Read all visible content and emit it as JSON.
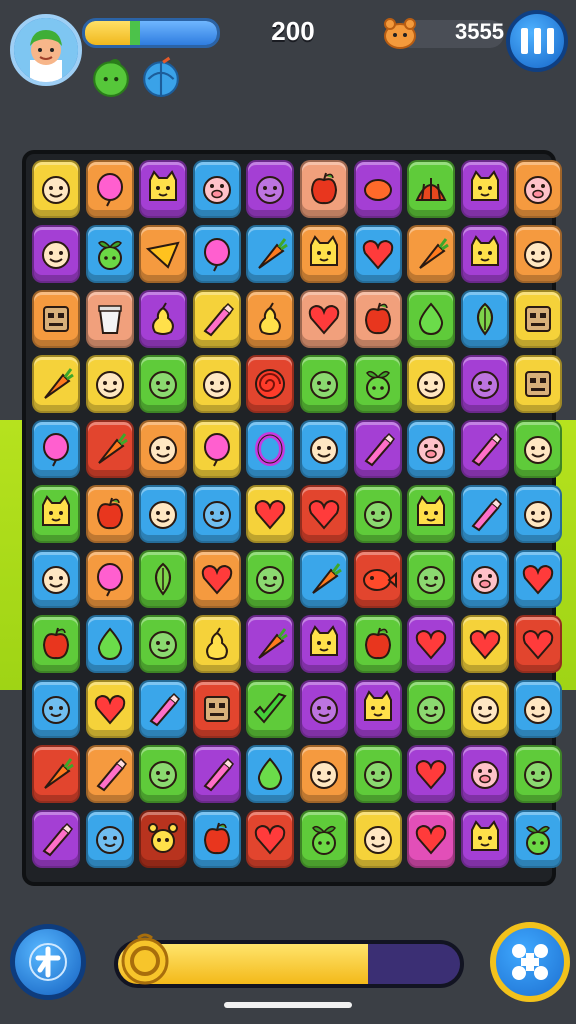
{
  "hud": {
    "score": "200",
    "coins": "3555",
    "xp_fraction": 0.37,
    "boosters": [
      "green-apple-icon",
      "blue-ball-icon"
    ],
    "pause_icon": "pause-icon"
  },
  "footer": {
    "hint_icon": "hint-icon",
    "shuffle_icon": "shuffle-icon",
    "level_progress": 0.73
  },
  "tile_colors": {
    "yellow": "#f5d23a",
    "orange": "#f59a3f",
    "purple": "#a43fd4",
    "blue": "#3aa6ea",
    "green": "#5fcb3a",
    "red": "#e2452e",
    "pink": "#e24fb8",
    "peach": "#f1a07c",
    "darkred": "#b8331e",
    "darkblue": "#2b5fba"
  },
  "board": {
    "rows": [
      [
        [
          "yellow",
          "face"
        ],
        [
          "orange",
          "balloon"
        ],
        [
          "purple",
          "cat"
        ],
        [
          "blue",
          "pig"
        ],
        [
          "purple",
          "blob"
        ],
        [
          "peach",
          "apple"
        ],
        [
          "purple",
          "fruit"
        ],
        [
          "green",
          "shell"
        ],
        [
          "purple",
          "cat"
        ],
        [
          "orange",
          "pig"
        ]
      ],
      [
        [
          "purple",
          "face"
        ],
        [
          "blue",
          "sprout"
        ],
        [
          "orange",
          "cheese"
        ],
        [
          "blue",
          "balloon"
        ],
        [
          "blue",
          "carrot"
        ],
        [
          "orange",
          "cat"
        ],
        [
          "blue",
          "heart"
        ],
        [
          "orange",
          "carrot"
        ],
        [
          "purple",
          "cat"
        ],
        [
          "orange",
          "face"
        ]
      ],
      [
        [
          "orange",
          "robot"
        ],
        [
          "peach",
          "cup"
        ],
        [
          "purple",
          "pear"
        ],
        [
          "yellow",
          "crayon"
        ],
        [
          "orange",
          "pear"
        ],
        [
          "peach",
          "heart"
        ],
        [
          "peach",
          "apple"
        ],
        [
          "green",
          "drop"
        ],
        [
          "blue",
          "leaf"
        ],
        [
          "yellow",
          "robot"
        ]
      ],
      [
        [
          "yellow",
          "carrot"
        ],
        [
          "yellow",
          "face"
        ],
        [
          "green",
          "blob"
        ],
        [
          "yellow",
          "face"
        ],
        [
          "red",
          "swirl"
        ],
        [
          "green",
          "blob"
        ],
        [
          "green",
          "sprout"
        ],
        [
          "yellow",
          "face"
        ],
        [
          "purple",
          "blob"
        ],
        [
          "yellow",
          "robot"
        ]
      ],
      [
        [
          "blue",
          "balloon"
        ],
        [
          "red",
          "carrot"
        ],
        [
          "orange",
          "face"
        ],
        [
          "yellow",
          "balloon"
        ],
        [
          "blue",
          "ring"
        ],
        [
          "blue",
          "face"
        ],
        [
          "purple",
          "crayon"
        ],
        [
          "blue",
          "pig"
        ],
        [
          "purple",
          "crayon"
        ],
        [
          "green",
          "face"
        ]
      ],
      [
        [
          "green",
          "cat"
        ],
        [
          "orange",
          "apple"
        ],
        [
          "blue",
          "face"
        ],
        [
          "blue",
          "blob"
        ],
        [
          "yellow",
          "heart"
        ],
        [
          "red",
          "heart"
        ],
        [
          "green",
          "blob"
        ],
        [
          "green",
          "cat"
        ],
        [
          "blue",
          "crayon"
        ],
        [
          "blue",
          "face"
        ]
      ],
      [
        [
          "blue",
          "face"
        ],
        [
          "orange",
          "balloon"
        ],
        [
          "green",
          "leaf"
        ],
        [
          "orange",
          "heart"
        ],
        [
          "green",
          "blob"
        ],
        [
          "blue",
          "carrot"
        ],
        [
          "red",
          "fish"
        ],
        [
          "green",
          "blob"
        ],
        [
          "blue",
          "pig"
        ],
        [
          "blue",
          "heart"
        ]
      ],
      [
        [
          "green",
          "apple"
        ],
        [
          "blue",
          "drop"
        ],
        [
          "green",
          "blob"
        ],
        [
          "yellow",
          "pear"
        ],
        [
          "purple",
          "carrot"
        ],
        [
          "purple",
          "cat"
        ],
        [
          "green",
          "apple"
        ],
        [
          "purple",
          "heart"
        ],
        [
          "yellow",
          "heart"
        ],
        [
          "red",
          "heart"
        ]
      ],
      [
        [
          "blue",
          "blob"
        ],
        [
          "yellow",
          "heart"
        ],
        [
          "blue",
          "crayon"
        ],
        [
          "red",
          "robot"
        ],
        [
          "green",
          "check"
        ],
        [
          "purple",
          "blob"
        ],
        [
          "purple",
          "cat"
        ],
        [
          "green",
          "blob"
        ],
        [
          "yellow",
          "face"
        ],
        [
          "blue",
          "face"
        ]
      ],
      [
        [
          "red",
          "carrot"
        ],
        [
          "orange",
          "crayon"
        ],
        [
          "green",
          "blob"
        ],
        [
          "purple",
          "crayon"
        ],
        [
          "blue",
          "drop"
        ],
        [
          "orange",
          "face"
        ],
        [
          "green",
          "blob"
        ],
        [
          "purple",
          "heart"
        ],
        [
          "purple",
          "pig"
        ],
        [
          "green",
          "blob"
        ]
      ],
      [
        [
          "purple",
          "crayon"
        ],
        [
          "blue",
          "blob"
        ],
        [
          "darkred",
          "bug"
        ],
        [
          "blue",
          "apple"
        ],
        [
          "red",
          "heart"
        ],
        [
          "green",
          "sprout"
        ],
        [
          "yellow",
          "face"
        ],
        [
          "pink",
          "heart"
        ],
        [
          "purple",
          "cat"
        ],
        [
          "blue",
          "sprout"
        ]
      ]
    ]
  }
}
